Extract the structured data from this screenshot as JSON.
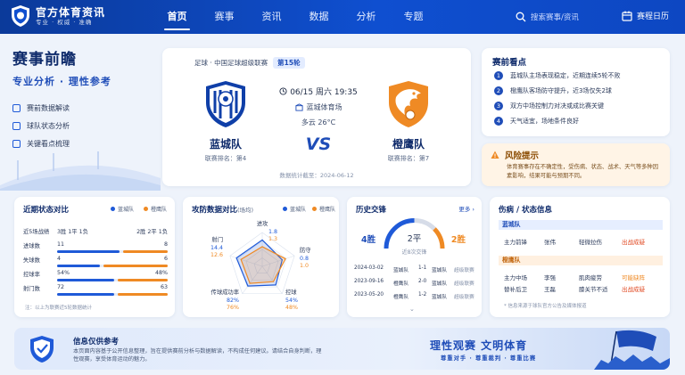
{
  "header": {
    "logo_title": "官方体育资讯",
    "logo_sub": "专业 · 权威 · 准确",
    "nav": [
      "首页",
      "赛事",
      "资讯",
      "数据",
      "分析",
      "专题"
    ],
    "search_placeholder": "搜索赛事/资讯",
    "calendar_label": "赛程日历"
  },
  "hero": {
    "title": "赛事前瞻",
    "subtitle": "专业分析 · 理性参考",
    "items": [
      "赛前数据解读",
      "球队状态分析",
      "关键看点梳理"
    ]
  },
  "match": {
    "league": "足球 · 中国足球超级联赛",
    "round": "第15轮",
    "datetime": "06/15 周六 19:35",
    "venue": "蓝城体育场",
    "weather": "多云 26°C",
    "vs": "VS",
    "home": {
      "name": "蓝城队",
      "rank": "联赛排名：第4"
    },
    "away": {
      "name": "橙鹰队",
      "rank": "联赛排名：第7"
    },
    "stat_date": "数据统计截至：2024-06-12"
  },
  "points": {
    "title": "赛前看点",
    "items": [
      "蓝城队主场表现稳定，近期连续5轮不败",
      "橙鹰队客场防守提升，近3场仅失2球",
      "双方中场控制力对决或成比赛关键",
      "天气适宜，场地条件良好"
    ]
  },
  "risk": {
    "title": "风险提示",
    "text": "体育赛事存在不确定性，受伤病、状态、战术、天气等多种因素影响，结果可能与预期不同。"
  },
  "form": {
    "title": "近期状态对比",
    "legend_home": "蓝城队",
    "legend_away": "橙鹰队",
    "rows": [
      {
        "label": "近5场战绩",
        "home": "3胜 1平 1负",
        "away": "2胜 2平 1负",
        "home_pct": 0,
        "away_pct": 0
      },
      {
        "label": "进球数",
        "home": "11",
        "away": "8",
        "home_pct": 0.58,
        "away_pct": 0.42
      },
      {
        "label": "失球数",
        "home": "4",
        "away": "6",
        "home_pct": 0.4,
        "away_pct": 0.6
      },
      {
        "label": "控球率",
        "home": "54%",
        "away": "48%",
        "home_pct": 0.53,
        "away_pct": 0.47
      },
      {
        "label": "射门数",
        "home": "72",
        "away": "63",
        "home_pct": 0.53,
        "away_pct": 0.47
      }
    ],
    "note": "注：以上为联赛近5轮数据统计"
  },
  "radar": {
    "title": "攻防数据对比",
    "title_unit": "(场均)",
    "legend_home": "蓝城队",
    "legend_away": "橙鹰队",
    "home_color": "#1f5ad8",
    "away_color": "#ef8a24"
  },
  "chart_data": {
    "type": "radar",
    "title": "攻防数据对比",
    "axes": [
      "进攻",
      "防守",
      "控球",
      "传球成功率",
      "射门"
    ],
    "series": [
      {
        "name": "蓝城队",
        "values": [
          1.8,
          0.8,
          54,
          82,
          14.4
        ],
        "labels": [
          "1.8",
          "0.8",
          "54%",
          "82%",
          "14.4"
        ]
      },
      {
        "name": "橙鹰队",
        "values": [
          1.3,
          1.0,
          48,
          76,
          12.6
        ],
        "labels": [
          "1.3",
          "1.0",
          "48%",
          "76%",
          "12.6"
        ]
      }
    ],
    "normalized": {
      "蓝城队": [
        0.78,
        0.62,
        0.68,
        0.72,
        0.8
      ],
      "橙鹰队": [
        0.58,
        0.72,
        0.56,
        0.62,
        0.66
      ]
    }
  },
  "history": {
    "title": "历史交锋",
    "more": "更多 ›",
    "home_wins": "4胜",
    "draws": "2平",
    "away_wins": "2胜",
    "total": "近8次交锋",
    "rows": [
      {
        "date": "2024-03-02",
        "home": "蓝城队",
        "score": "1-1",
        "away": "蓝城队",
        "tag": "超级联赛"
      },
      {
        "date": "2023-09-16",
        "home": "橙鹰队",
        "score": "2-0",
        "away": "蓝城队",
        "tag": "超级联赛"
      },
      {
        "date": "2023-05-20",
        "home": "橙鹰队",
        "score": "1-2",
        "away": "蓝城队",
        "tag": "超级联赛"
      }
    ]
  },
  "injury": {
    "title": "伤病 / 状态信息",
    "home_label": "蓝城队",
    "away_label": "橙鹰队",
    "home_rows": [
      {
        "pos": "主力前锋",
        "name": "张伟",
        "issue": "轻微拉伤",
        "status": "出战成疑"
      }
    ],
    "away_rows": [
      {
        "pos": "主力中场",
        "name": "李强",
        "issue": "肌肉疲劳",
        "status": "可能缺阵"
      },
      {
        "pos": "替补后卫",
        "name": "王磊",
        "issue": "膝关节不适",
        "status": "出战成疑"
      }
    ],
    "note": "* 信息来源于球队官方公告及媒体报道"
  },
  "footer": {
    "title": "信息仅供参考",
    "desc": "本页面内容基于公开信息整理，旨在提供赛前分析与数据解读，不构成任何建议。请结合自身判断，理性观赛，享受体育运动的魅力。",
    "slogan": "理性观赛   文明体育",
    "slogan_sub": "尊重对手 · 尊重裁判 · 尊重比赛"
  }
}
